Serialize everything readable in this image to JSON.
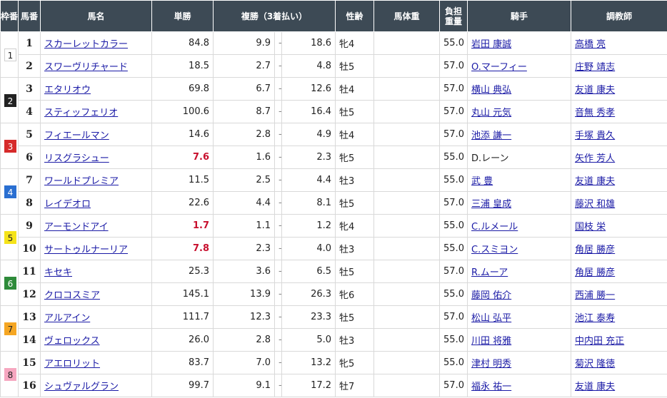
{
  "headers": {
    "waku": "枠番",
    "umaban": "馬番",
    "horse": "馬名",
    "win": "単勝",
    "place": "複勝（3着払い）",
    "sexage": "性齢",
    "weight": "馬体重",
    "futan": "負担\n重量",
    "jockey": "騎手",
    "trainer": "調教師"
  },
  "waku_colors": {
    "1": {
      "bg": "#ffffff",
      "fg": "#222222"
    },
    "2": {
      "bg": "#222222",
      "fg": "#ffffff"
    },
    "3": {
      "bg": "#d62b2b",
      "fg": "#ffffff"
    },
    "4": {
      "bg": "#2a6fd1",
      "fg": "#ffffff"
    },
    "5": {
      "bg": "#f5e31a",
      "fg": "#222222"
    },
    "6": {
      "bg": "#2e8b3a",
      "fg": "#ffffff"
    },
    "7": {
      "bg": "#f5a623",
      "fg": "#222222"
    },
    "8": {
      "bg": "#f6a7c0",
      "fg": "#222222"
    }
  },
  "groups": [
    {
      "waku": "1",
      "rows": [
        {
          "num": "1",
          "horse": "スカーレットカラー",
          "win": "84.8",
          "win_popular": false,
          "place_min": "9.9",
          "place_max": "18.6",
          "sexage": "牝4",
          "weight": "",
          "futan": "55.0",
          "jockey": "岩田 康誠",
          "jockey_link": true,
          "trainer": "高橋 亮",
          "trainer_link": true
        },
        {
          "num": "2",
          "horse": "スワーヴリチャード",
          "win": "18.5",
          "win_popular": false,
          "place_min": "2.7",
          "place_max": "4.8",
          "sexage": "牡5",
          "weight": "",
          "futan": "57.0",
          "jockey": "O.マーフィー",
          "jockey_link": true,
          "trainer": "庄野 靖志",
          "trainer_link": true
        }
      ]
    },
    {
      "waku": "2",
      "rows": [
        {
          "num": "3",
          "horse": "エタリオウ",
          "win": "69.8",
          "win_popular": false,
          "place_min": "6.7",
          "place_max": "12.6",
          "sexage": "牡4",
          "weight": "",
          "futan": "57.0",
          "jockey": "横山 典弘",
          "jockey_link": true,
          "trainer": "友道 康夫",
          "trainer_link": true
        },
        {
          "num": "4",
          "horse": "スティッフェリオ",
          "win": "100.6",
          "win_popular": false,
          "place_min": "8.7",
          "place_max": "16.4",
          "sexage": "牡5",
          "weight": "",
          "futan": "57.0",
          "jockey": "丸山 元気",
          "jockey_link": true,
          "trainer": "音無 秀孝",
          "trainer_link": true
        }
      ]
    },
    {
      "waku": "3",
      "rows": [
        {
          "num": "5",
          "horse": "フィエールマン",
          "win": "14.6",
          "win_popular": false,
          "place_min": "2.8",
          "place_max": "4.9",
          "sexage": "牡4",
          "weight": "",
          "futan": "57.0",
          "jockey": "池添 謙一",
          "jockey_link": true,
          "trainer": "手塚 貴久",
          "trainer_link": true
        },
        {
          "num": "6",
          "horse": "リスグラシュー",
          "win": "7.6",
          "win_popular": true,
          "place_min": "1.6",
          "place_max": "2.3",
          "sexage": "牝5",
          "weight": "",
          "futan": "55.0",
          "jockey": "D.レーン",
          "jockey_link": false,
          "trainer": "矢作 芳人",
          "trainer_link": true
        }
      ]
    },
    {
      "waku": "4",
      "rows": [
        {
          "num": "7",
          "horse": "ワールドプレミア",
          "win": "11.5",
          "win_popular": false,
          "place_min": "2.5",
          "place_max": "4.4",
          "sexage": "牡3",
          "weight": "",
          "futan": "55.0",
          "jockey": "武 豊",
          "jockey_link": true,
          "trainer": "友道 康夫",
          "trainer_link": true
        },
        {
          "num": "8",
          "horse": "レイデオロ",
          "win": "22.6",
          "win_popular": false,
          "place_min": "4.4",
          "place_max": "8.1",
          "sexage": "牡5",
          "weight": "",
          "futan": "57.0",
          "jockey": "三浦 皇成",
          "jockey_link": true,
          "trainer": "藤沢 和雄",
          "trainer_link": true
        }
      ]
    },
    {
      "waku": "5",
      "rows": [
        {
          "num": "9",
          "horse": "アーモンドアイ",
          "win": "1.7",
          "win_popular": true,
          "place_min": "1.1",
          "place_max": "1.2",
          "sexage": "牝4",
          "weight": "",
          "futan": "55.0",
          "jockey": "C.ルメール",
          "jockey_link": true,
          "trainer": "国枝 栄",
          "trainer_link": true
        },
        {
          "num": "10",
          "horse": "サートゥルナーリア",
          "win": "7.8",
          "win_popular": true,
          "place_min": "2.3",
          "place_max": "4.0",
          "sexage": "牡3",
          "weight": "",
          "futan": "55.0",
          "jockey": "C.スミヨン",
          "jockey_link": true,
          "trainer": "角居 勝彦",
          "trainer_link": true
        }
      ]
    },
    {
      "waku": "6",
      "rows": [
        {
          "num": "11",
          "horse": "キセキ",
          "win": "25.3",
          "win_popular": false,
          "place_min": "3.6",
          "place_max": "6.5",
          "sexage": "牡5",
          "weight": "",
          "futan": "57.0",
          "jockey": "R.ムーア",
          "jockey_link": true,
          "trainer": "角居 勝彦",
          "trainer_link": true
        },
        {
          "num": "12",
          "horse": "クロコスミア",
          "win": "145.1",
          "win_popular": false,
          "place_min": "13.9",
          "place_max": "26.3",
          "sexage": "牝6",
          "weight": "",
          "futan": "55.0",
          "jockey": "藤岡 佑介",
          "jockey_link": true,
          "trainer": "西浦 勝一",
          "trainer_link": true
        }
      ]
    },
    {
      "waku": "7",
      "rows": [
        {
          "num": "13",
          "horse": "アルアイン",
          "win": "111.7",
          "win_popular": false,
          "place_min": "12.3",
          "place_max": "23.3",
          "sexage": "牡5",
          "weight": "",
          "futan": "57.0",
          "jockey": "松山 弘平",
          "jockey_link": true,
          "trainer": "池江 泰寿",
          "trainer_link": true
        },
        {
          "num": "14",
          "horse": "ヴェロックス",
          "win": "26.0",
          "win_popular": false,
          "place_min": "2.8",
          "place_max": "5.0",
          "sexage": "牡3",
          "weight": "",
          "futan": "55.0",
          "jockey": "川田 将雅",
          "jockey_link": true,
          "trainer": "中内田 充正",
          "trainer_link": true
        }
      ]
    },
    {
      "waku": "8",
      "rows": [
        {
          "num": "15",
          "horse": "アエロリット",
          "win": "83.7",
          "win_popular": false,
          "place_min": "7.0",
          "place_max": "13.2",
          "sexage": "牝5",
          "weight": "",
          "futan": "55.0",
          "jockey": "津村 明秀",
          "jockey_link": true,
          "trainer": "菊沢 隆徳",
          "trainer_link": true
        },
        {
          "num": "16",
          "horse": "シュヴァルグラン",
          "win": "99.7",
          "win_popular": false,
          "place_min": "9.1",
          "place_max": "17.2",
          "sexage": "牡7",
          "weight": "",
          "futan": "57.0",
          "jockey": "福永 祐一",
          "jockey_link": true,
          "trainer": "友道 康夫",
          "trainer_link": true
        }
      ]
    }
  ],
  "place_separator": "-"
}
